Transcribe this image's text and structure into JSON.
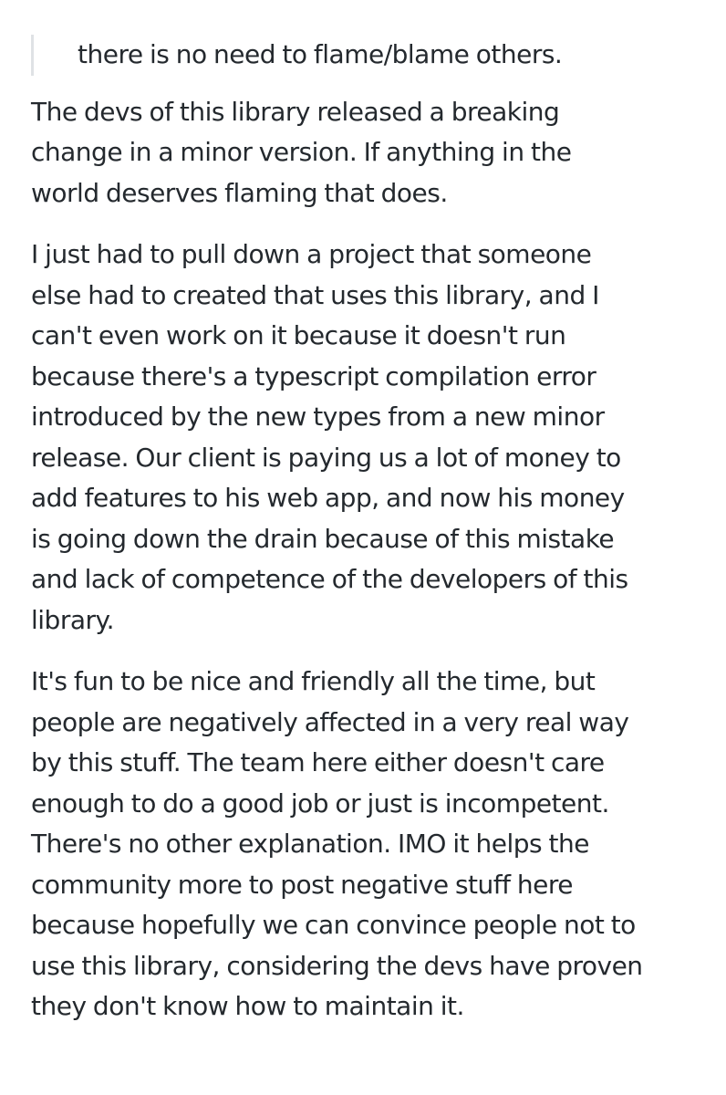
{
  "quote": {
    "text": "there is no need to flame/blame others."
  },
  "paragraphs": [
    {
      "lines": [
        "The devs of this library released a breaking",
        "change in a minor version. If anything in the",
        "world deserves flaming that does."
      ]
    },
    {
      "lines": [
        "I just had to pull down a project that someone",
        "else had to created that uses this library, and I",
        "can't even work on it because it doesn't run",
        "because there's a typescript compilation error",
        "introduced by the new types from a new minor",
        "release. Our client is paying us a lot of money to",
        "add features to his web app, and now his money",
        "is going down the drain because of this mistake",
        "and lack of competence of the developers of this",
        "library."
      ]
    },
    {
      "lines": [
        "It's fun to be nice and friendly all the time, but",
        "people are negatively affected in a very real way",
        "by this stuff. The team here either doesn't care",
        "enough to do a good job or just is incompetent.",
        "There's no other explanation. IMO it helps the",
        "community more to post negative stuff here",
        "because hopefully we can convince people not to",
        "use this library, considering the devs have proven",
        "they don't know how to maintain it."
      ]
    }
  ]
}
